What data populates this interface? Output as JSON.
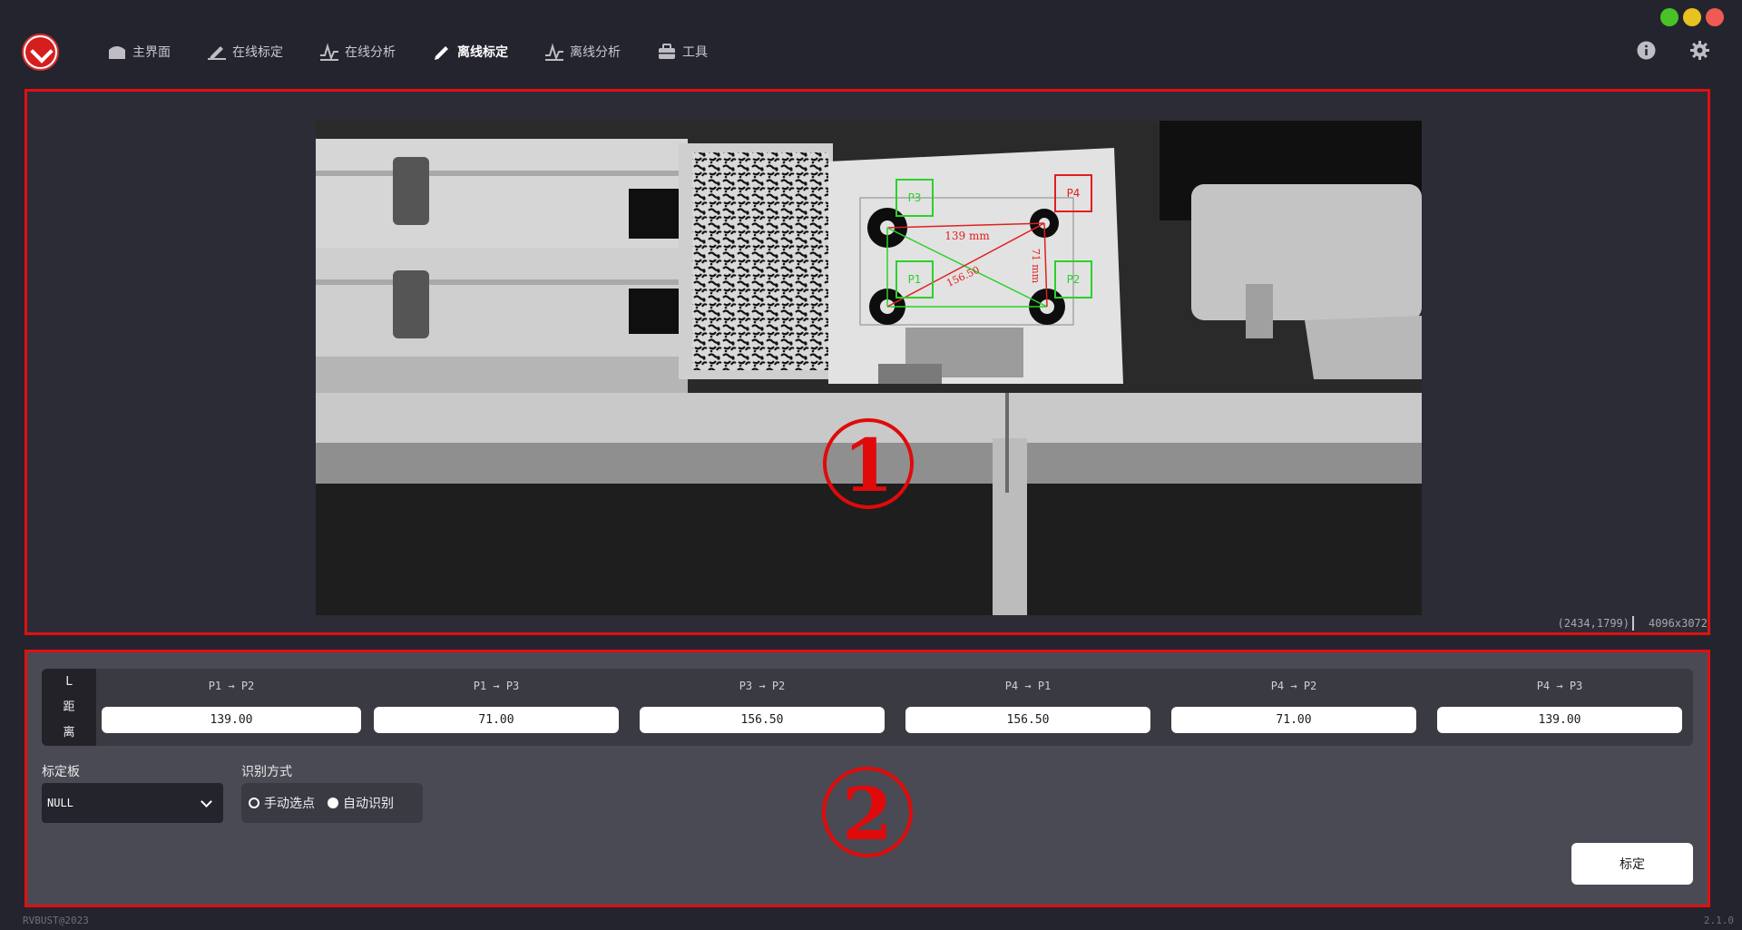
{
  "colors": {
    "accent_red": "#e01010",
    "window_close": "#f05a54",
    "window_max": "#e8c21e",
    "window_min": "#49c228",
    "target_green": "#2bd12b",
    "target_red": "#e02020"
  },
  "nav": {
    "items": [
      {
        "label": "主界面",
        "icon": "home-icon"
      },
      {
        "label": "在线标定",
        "icon": "pencil-icon"
      },
      {
        "label": "在线分析",
        "icon": "pulse-icon"
      },
      {
        "label": "离线标定",
        "icon": "pencil-icon",
        "active": true
      },
      {
        "label": "离线分析",
        "icon": "pulse-icon"
      },
      {
        "label": "工具",
        "icon": "toolbox-icon"
      }
    ]
  },
  "topbar": {
    "info_icon": "info-icon",
    "settings_icon": "gear-icon"
  },
  "viewer": {
    "coordinate": "(2434,1799)",
    "resolution": "4096x3072",
    "region_number": "1",
    "overlay": {
      "points": [
        "P1",
        "P2",
        "P3",
        "P4"
      ],
      "label_h": "139 mm",
      "label_v": "71 mm",
      "label_d": "156.50"
    }
  },
  "controls": {
    "region_number": "2",
    "distance_label": [
      "L",
      "距",
      "离"
    ],
    "distances": [
      {
        "pair": "P1 → P2",
        "value": "139.00"
      },
      {
        "pair": "P1 → P3",
        "value": "71.00"
      },
      {
        "pair": "P3 → P2",
        "value": "156.50"
      },
      {
        "pair": "P4 → P1",
        "value": "156.50"
      },
      {
        "pair": "P4 → P2",
        "value": "71.00"
      },
      {
        "pair": "P4 → P3",
        "value": "139.00"
      }
    ],
    "board_title": "标定板",
    "board_value": "NULL",
    "mode_title": "识别方式",
    "mode_options": [
      {
        "label": "手动选点",
        "selected": false
      },
      {
        "label": "自动识别",
        "selected": true
      }
    ],
    "calibrate_label": "标定"
  },
  "footer": {
    "copyright": "RVBUST@2023",
    "version": "2.1.0"
  }
}
